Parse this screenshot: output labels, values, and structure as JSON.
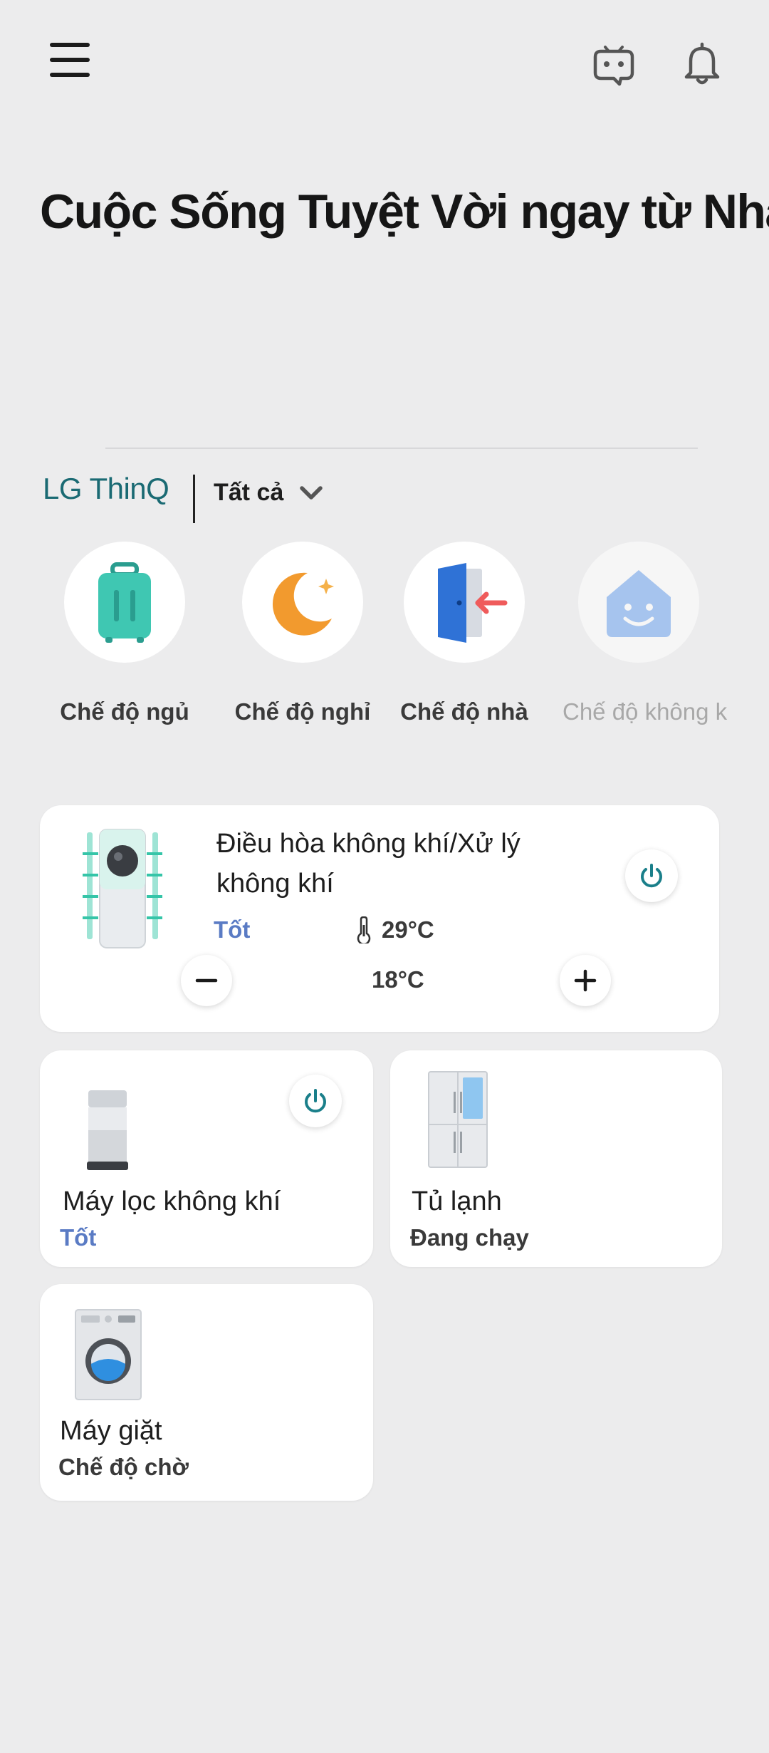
{
  "header": {
    "menu_icon": "hamburger-menu-icon",
    "assistant_icon": "chatbot-icon",
    "notification_icon": "bell-icon",
    "title": "Cuộc Sống Tuyệt Vời ngay từ Nhà"
  },
  "home": {
    "brand": "LG ThinQ",
    "filter": {
      "selected": "Tất cả",
      "icon": "chevron-down-icon"
    }
  },
  "scenes": [
    {
      "label": "Chế độ ngủ",
      "icon": "suitcase-icon"
    },
    {
      "label": "Chế độ nghỉ",
      "icon": "moon-star-icon"
    },
    {
      "label": "Chế độ nhà",
      "icon": "door-enter-icon"
    },
    {
      "label": "Chế độ không k",
      "icon": "smiling-house-icon"
    }
  ],
  "devices": {
    "air_conditioner": {
      "name_line1": "Điều hòa không khí/Xử lý",
      "name_line2": "không khí",
      "status": "Tốt",
      "current_temp": "29°C",
      "target_temp": "18°C",
      "icon": "air-conditioner-icon"
    },
    "air_purifier": {
      "name": "Máy lọc không khí",
      "status": "Tốt",
      "icon": "air-purifier-icon"
    },
    "refrigerator": {
      "name": "Tủ lạnh",
      "status": "Đang chạy",
      "icon": "refrigerator-icon"
    },
    "washer": {
      "name": "Máy giặt",
      "status": "Chế độ chờ",
      "icon": "washing-machine-icon"
    }
  },
  "colors": {
    "background": "#ececed",
    "brand": "#1a6a73",
    "status_good": "#5a7bc4",
    "power_teal": "#1a7f8a"
  }
}
